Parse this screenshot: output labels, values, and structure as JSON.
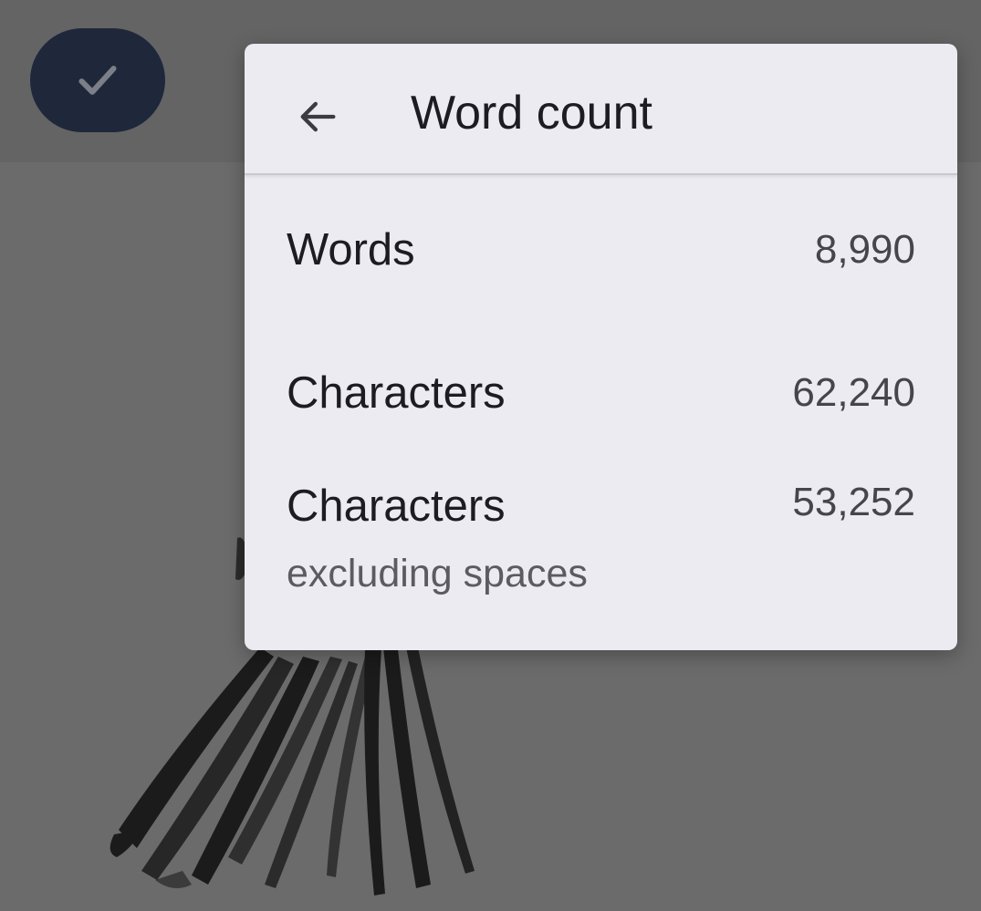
{
  "toolbar": {
    "done_icon": "check-icon"
  },
  "dialog": {
    "back_icon": "arrow-back-icon",
    "title": "Word count",
    "stats": [
      {
        "label": "Words",
        "value": "8,990"
      },
      {
        "label": "Characters",
        "value": "62,240"
      },
      {
        "label": "Characters",
        "sublabel": "excluding spaces",
        "value": "53,252"
      }
    ]
  },
  "colors": {
    "scrim": "#6b6b6b",
    "topbar": "#646465",
    "button": "#1f283a",
    "dialog": "#ecebf1",
    "text": "#1d1c20"
  }
}
